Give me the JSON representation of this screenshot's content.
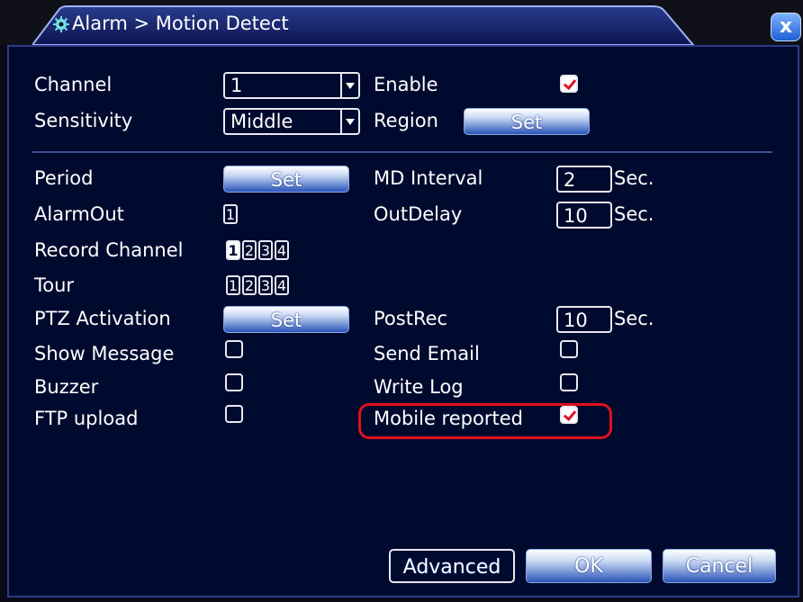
{
  "title": "Alarm > Motion Detect",
  "close": "x",
  "channel": {
    "label": "Channel",
    "value": "1"
  },
  "enable": {
    "label": "Enable",
    "checked": true
  },
  "sensitivity": {
    "label": "Sensitivity",
    "value": "Middle"
  },
  "region": {
    "label": "Region",
    "button": "Set"
  },
  "period": {
    "label": "Period",
    "button": "Set"
  },
  "md_interval": {
    "label": "MD Interval",
    "value": "2",
    "unit": "Sec."
  },
  "alarm_out": {
    "label": "AlarmOut",
    "boxes": [
      "1"
    ]
  },
  "out_delay": {
    "label": "OutDelay",
    "value": "10",
    "unit": "Sec."
  },
  "record_channel": {
    "label": "Record Channel",
    "boxes": [
      "1",
      "2",
      "3",
      "4"
    ]
  },
  "tour": {
    "label": "Tour",
    "boxes": [
      "1",
      "2",
      "3",
      "4"
    ]
  },
  "ptz": {
    "label": "PTZ Activation",
    "button": "Set"
  },
  "post_rec": {
    "label": "PostRec",
    "value": "10",
    "unit": "Sec."
  },
  "show_message": {
    "label": "Show Message",
    "checked": false
  },
  "send_email": {
    "label": "Send Email",
    "checked": false
  },
  "buzzer": {
    "label": "Buzzer",
    "checked": false
  },
  "write_log": {
    "label": "Write Log",
    "checked": false
  },
  "ftp_upload": {
    "label": "FTP upload",
    "checked": false
  },
  "mobile_reported": {
    "label": "Mobile reported",
    "checked": true
  },
  "footer": {
    "advanced": "Advanced",
    "ok": "OK",
    "cancel": "Cancel"
  },
  "colors": {
    "panel": "#000a2e",
    "border": "#2c3a8c",
    "highlight": "#e01020",
    "check": "#e0142a"
  }
}
